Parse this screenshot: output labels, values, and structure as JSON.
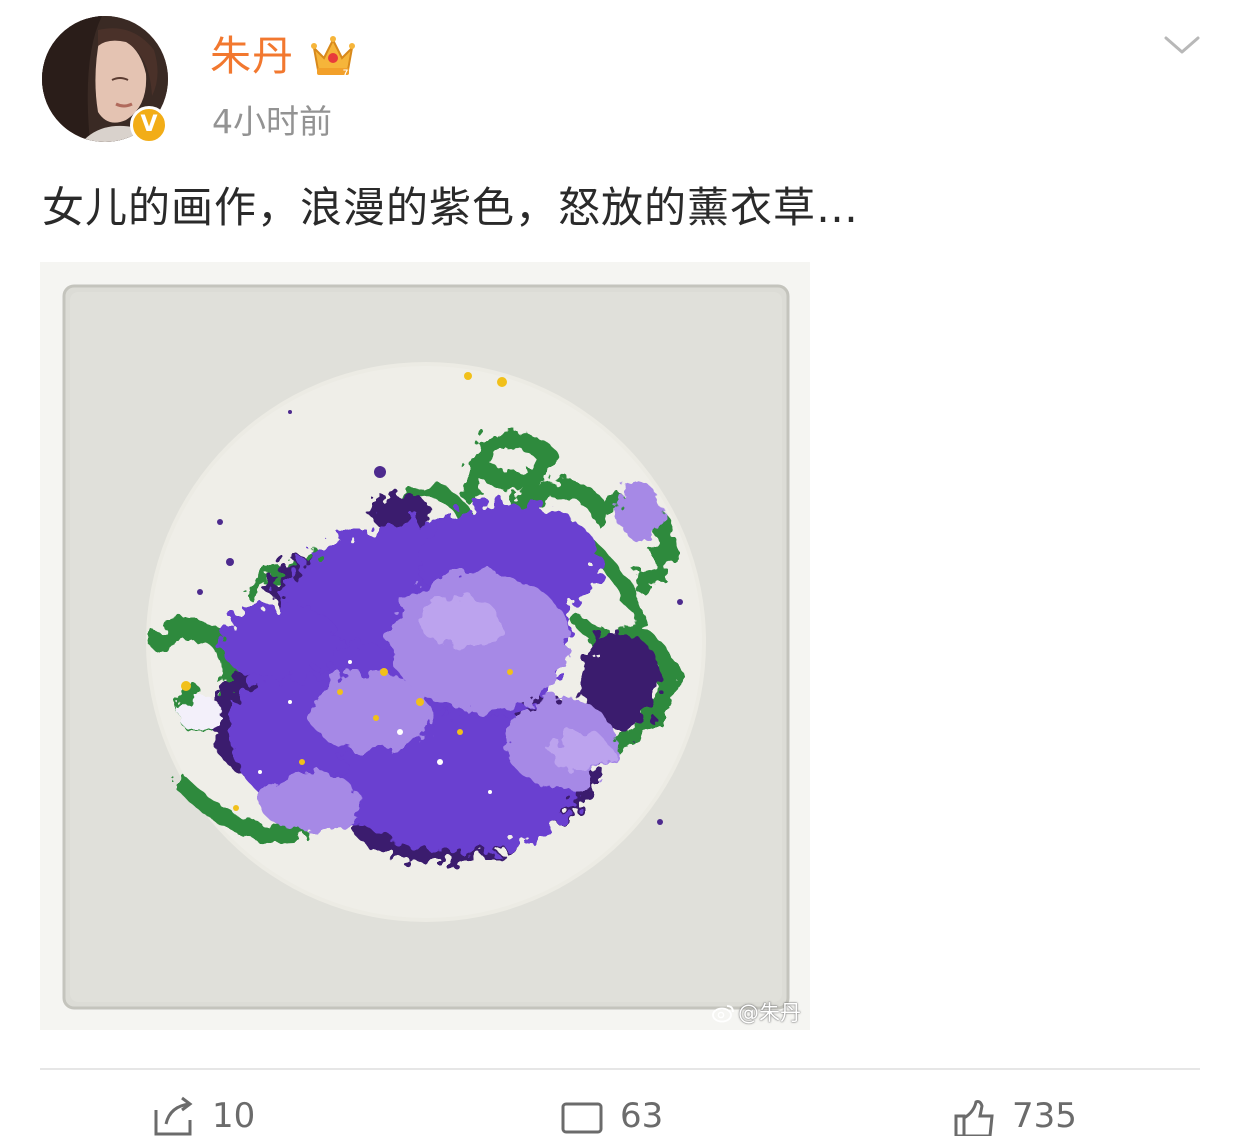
{
  "post": {
    "author": "朱丹",
    "timestamp": "4小时前",
    "text": "女儿的画作，浪漫的紫色，怒放的薰衣草…",
    "verified_mark": "V",
    "watermark": "@朱丹"
  },
  "actions": {
    "repost_count": "10",
    "comment_count": "63",
    "like_count": "735"
  },
  "icons": {
    "crown": "crown-icon",
    "chevron": "chevron-down-icon",
    "repost": "repost-icon",
    "comment": "comment-icon",
    "like": "thumbs-up-icon",
    "weibo": "weibo-logo-icon"
  },
  "colors": {
    "author_name": "#f2782f",
    "verified_badge": "#f2ad17",
    "timestamp": "#939393",
    "text": "#2a2a2a",
    "painting_purple": "#6a3fd0",
    "painting_lavender": "#a689e6",
    "painting_green": "#2d8a3e"
  }
}
